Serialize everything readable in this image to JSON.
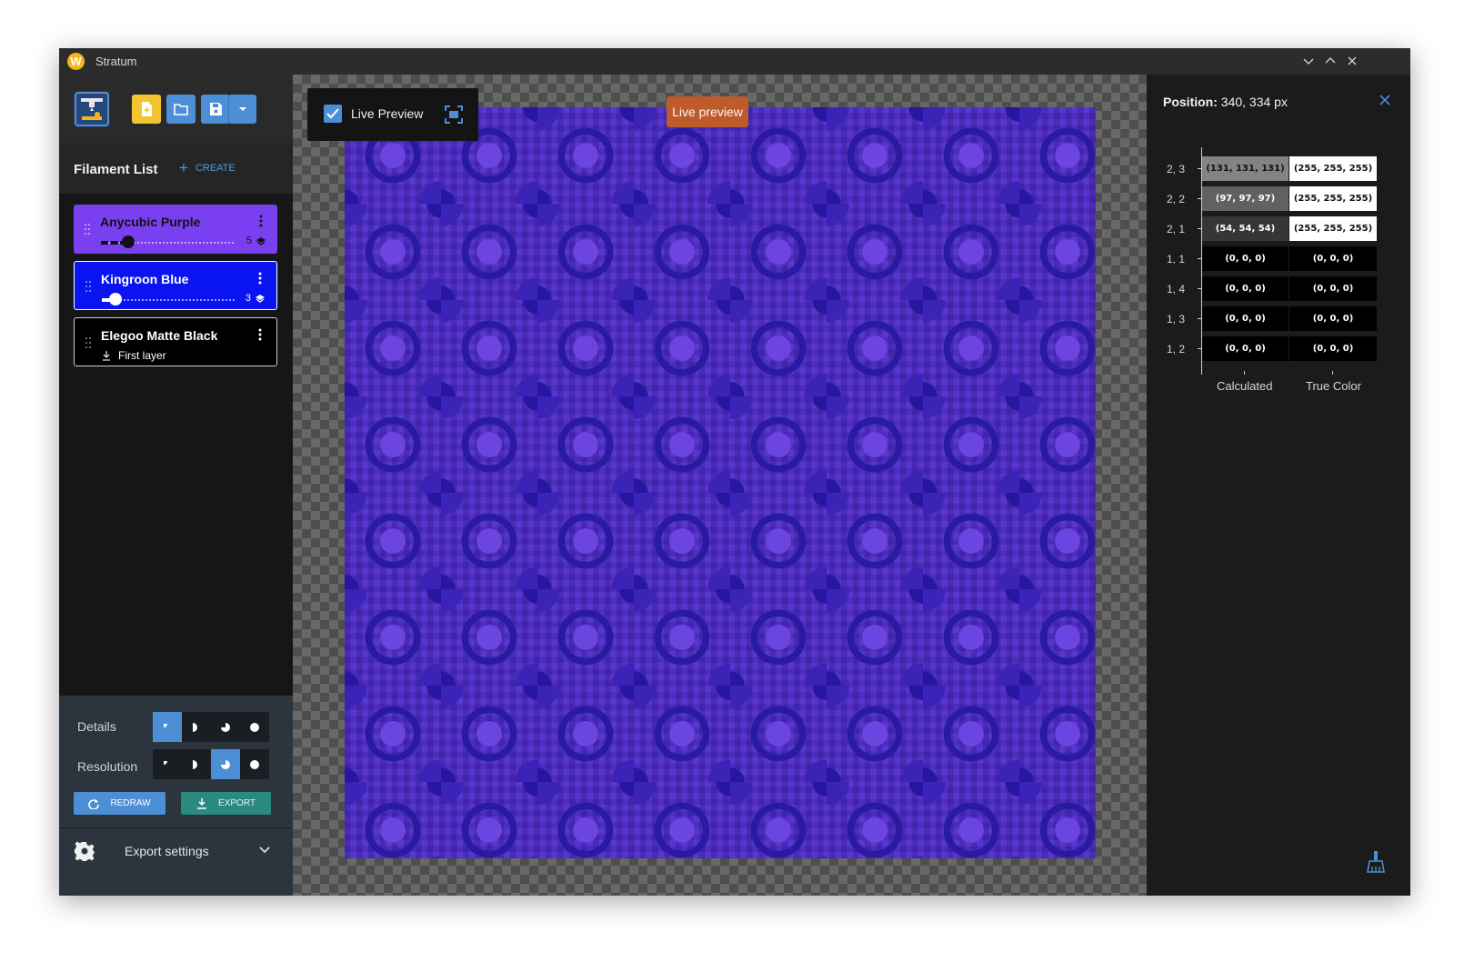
{
  "window": {
    "title": "Stratum",
    "app_icon_letter": "W"
  },
  "sidebar": {
    "filament_list_title": "Filament List",
    "create_label": "CREATE",
    "filaments": [
      {
        "name": "Anycubic Purple",
        "layers": "5",
        "color": "#7b3ff2",
        "layer_fraction": 0.2
      },
      {
        "name": "Kingroon Blue",
        "layers": "3",
        "color": "#0a14f0",
        "layer_fraction": 0.1
      },
      {
        "name": "Elegoo Matte Black",
        "first_layer": "First layer",
        "color": "#000000"
      }
    ],
    "details_label": "Details",
    "resolution_label": "Resolution",
    "details_selected": 0,
    "resolution_selected": 2,
    "redraw_label": "REDRAW",
    "export_label": "EXPORT",
    "export_settings_label": "Export settings"
  },
  "canvas": {
    "live_preview_label": "Live Preview",
    "live_preview_checked": true,
    "badge_label": "Live preview"
  },
  "inspector": {
    "position_label": "Position:",
    "position_value": "340, 334 px",
    "rows": [
      {
        "label": "2, 3",
        "calculated": "(131, 131, 131)",
        "calc_color": "#838383",
        "true_color": "(255, 255, 255)",
        "true_color_hex": "#ffffff"
      },
      {
        "label": "2, 2",
        "calculated": "(97, 97, 97)",
        "calc_color": "#616161",
        "true_color": "(255, 255, 255)",
        "true_color_hex": "#ffffff"
      },
      {
        "label": "2, 1",
        "calculated": "(54, 54, 54)",
        "calc_color": "#363636",
        "true_color": "(255, 255, 255)",
        "true_color_hex": "#ffffff"
      },
      {
        "label": "1, 1",
        "calculated": "(0, 0, 0)",
        "calc_color": "#000000",
        "true_color": "(0, 0, 0)",
        "true_color_hex": "#000000"
      },
      {
        "label": "1, 4",
        "calculated": "(0, 0, 0)",
        "calc_color": "#000000",
        "true_color": "(0, 0, 0)",
        "true_color_hex": "#000000"
      },
      {
        "label": "1, 3",
        "calculated": "(0, 0, 0)",
        "calc_color": "#000000",
        "true_color": "(0, 0, 0)",
        "true_color_hex": "#000000"
      },
      {
        "label": "1, 2",
        "calculated": "(0, 0, 0)",
        "calc_color": "#000000",
        "true_color": "(0, 0, 0)",
        "true_color_hex": "#000000"
      }
    ],
    "x_labels": [
      "Calculated",
      "True Color"
    ]
  }
}
